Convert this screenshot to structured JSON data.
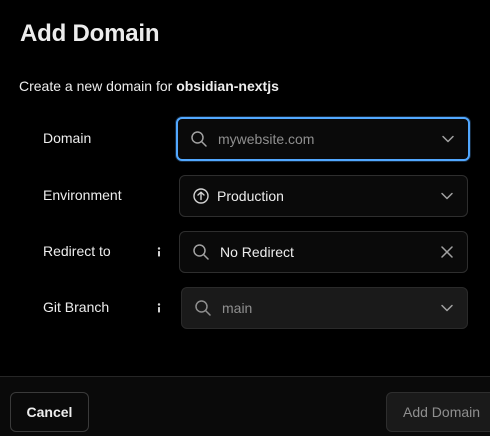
{
  "dialog": {
    "title": "Add Domain",
    "subtitle_prefix": "Create a new domain for ",
    "project_name": "obsidian-nextjs"
  },
  "fields": {
    "domain": {
      "label": "Domain",
      "placeholder": "mywebsite.com",
      "value": ""
    },
    "environment": {
      "label": "Environment",
      "value": "Production"
    },
    "redirect": {
      "label": "Redirect to",
      "value": "No Redirect"
    },
    "git_branch": {
      "label": "Git Branch",
      "placeholder": "main"
    }
  },
  "footer": {
    "cancel_label": "Cancel",
    "submit_label": "Add Domain"
  },
  "colors": {
    "background": "#000000",
    "focus_ring": "#52a8ff",
    "text_primary": "#ededed",
    "text_muted": "#8f8f8f",
    "border": "#2e2e2e"
  },
  "icons": {
    "search": "search-icon",
    "environment": "arrow-up-circle-icon",
    "dropdown": "chevron-down-icon",
    "clear": "close-icon",
    "info": "info-icon"
  }
}
